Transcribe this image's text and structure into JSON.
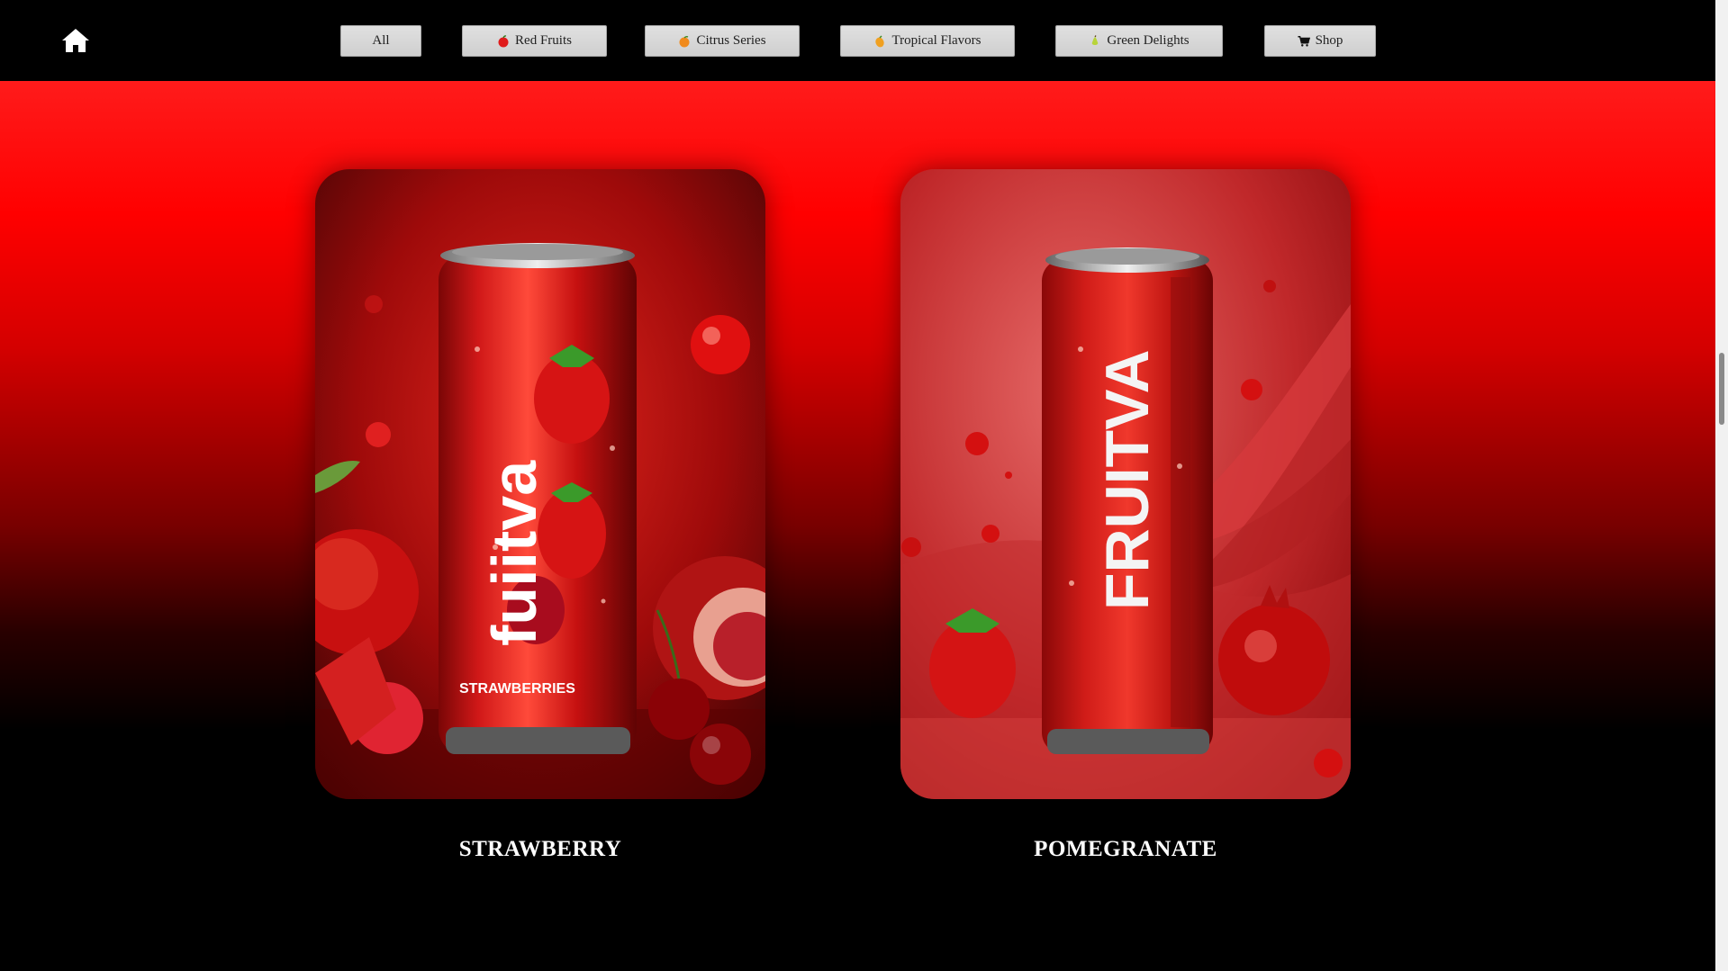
{
  "nav": {
    "home_icon": "home-icon",
    "buttons": [
      {
        "label": "All",
        "icon": ""
      },
      {
        "label": "Red Fruits",
        "icon": "apple-icon"
      },
      {
        "label": "Citrus Series",
        "icon": "orange-icon"
      },
      {
        "label": "Tropical Flavors",
        "icon": "mango-icon"
      },
      {
        "label": "Green Delights",
        "icon": "pear-icon"
      },
      {
        "label": "Shop",
        "icon": "cart-icon"
      }
    ]
  },
  "products": [
    {
      "name": "STRAWBERRY",
      "can_text": "fuiitva",
      "can_subtext": "STRAWBERRIES"
    },
    {
      "name": "POMEGRANATE",
      "can_text": "FRUITVA"
    }
  ],
  "colors": {
    "accent": "#ff0000",
    "background": "#000000"
  }
}
